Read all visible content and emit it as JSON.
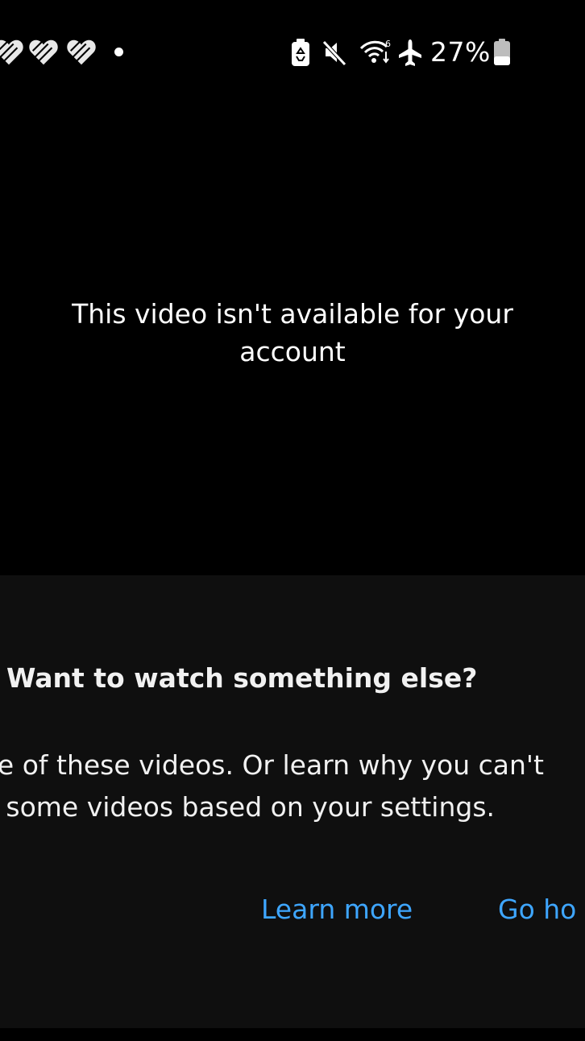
{
  "status_bar": {
    "notification_icons": [
      "heart-icon",
      "heart-icon",
      "heart-icon"
    ],
    "icons": [
      "battery-saver-icon",
      "mute-icon",
      "wifi-6-icon",
      "airplane-mode-icon"
    ],
    "battery_percent": "27%"
  },
  "player": {
    "message_line1": "This video isn't available for your",
    "message_line2": "account"
  },
  "panel": {
    "heading": "Want to watch something else?",
    "body_line1": "ne of these videos. Or learn why you can't",
    "body_line2": "n some videos based on your settings.",
    "learn_more_label": "Learn more",
    "go_home_label": "Go ho"
  },
  "colors": {
    "background": "#000000",
    "panel_background": "#0f0f0f",
    "text": "#f1f1f1",
    "link": "#3ea6ff"
  }
}
